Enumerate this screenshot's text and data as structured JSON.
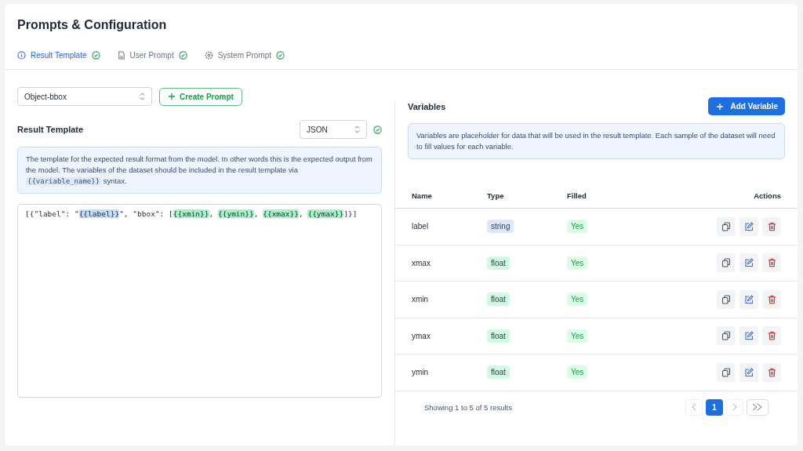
{
  "title": "Prompts & Configuration",
  "tabs": [
    {
      "label": "Result Template",
      "kind": "info",
      "selected": true,
      "done": true
    },
    {
      "label": "User Prompt",
      "kind": "file",
      "selected": false,
      "done": true
    },
    {
      "label": "System Prompt",
      "kind": "gear",
      "selected": false,
      "done": true
    }
  ],
  "prompt_select": {
    "value": "Object-bbox"
  },
  "create_button": "Create Prompt",
  "template": {
    "heading": "Result Template",
    "format": {
      "value": "JSON",
      "valid": true
    },
    "info": [
      {
        "kind": "text",
        "text": "The template for the expected result format from the model. In other words this is the expected output from the model. The variables of the dataset should be included in the result template via "
      },
      {
        "kind": "code",
        "text": "{{variable_name}}"
      },
      {
        "kind": "text",
        "text": " syntax."
      }
    ],
    "code": [
      {
        "kind": "text",
        "text": "[{\"label\": \""
      },
      {
        "kind": "string",
        "text": "{{label}}"
      },
      {
        "kind": "text",
        "text": "\", \"bbox\": ["
      },
      {
        "kind": "float",
        "text": "{{xmin}}"
      },
      {
        "kind": "text",
        "text": ", "
      },
      {
        "kind": "float",
        "text": "{{ymin}}"
      },
      {
        "kind": "text",
        "text": ", "
      },
      {
        "kind": "float",
        "text": "{{xmax}}"
      },
      {
        "kind": "text",
        "text": ", "
      },
      {
        "kind": "float",
        "text": "{{ymax}}"
      },
      {
        "kind": "text",
        "text": "]}]"
      }
    ]
  },
  "variables": {
    "heading": "Variables",
    "add_button": "Add Variable",
    "info": "Variables are placeholder for data that will be used in the result template. Each sample of the dataset will need to fill values for each variable.",
    "columns": [
      "Name",
      "Type",
      "Filled",
      "Actions"
    ],
    "rows": [
      {
        "name": "label",
        "type": {
          "label": "string",
          "color": "#dbe8fd"
        },
        "filled": "Yes"
      },
      {
        "name": "xmax",
        "type": {
          "label": "float",
          "color": "#d1fae5"
        },
        "filled": "Yes"
      },
      {
        "name": "xmin",
        "type": {
          "label": "float",
          "color": "#d1fae5"
        },
        "filled": "Yes"
      },
      {
        "name": "ymax",
        "type": {
          "label": "float",
          "color": "#d1fae5"
        },
        "filled": "Yes"
      },
      {
        "name": "ymin",
        "type": {
          "label": "float",
          "color": "#d1fae5"
        },
        "filled": "Yes"
      }
    ],
    "summary": "Showing 1 to 5 of 5 results",
    "pages": [
      {
        "label": "1",
        "selected": true
      }
    ]
  }
}
